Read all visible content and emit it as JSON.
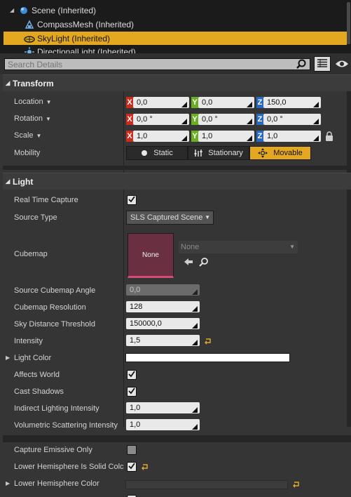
{
  "tree": {
    "items": [
      {
        "label": "Scene (Inherited)",
        "icon": "scene-icon",
        "expanded": true,
        "selected": false
      },
      {
        "label": "CompassMesh (Inherited)",
        "icon": "static-mesh-icon",
        "selected": false
      },
      {
        "label": "SkyLight (Inherited)",
        "icon": "skylight-icon",
        "selected": true
      },
      {
        "label": "DirectionalLight (Inherited)",
        "icon": "directional-light-icon",
        "selected": false
      }
    ]
  },
  "search": {
    "placeholder": "Search Details"
  },
  "transform": {
    "title": "Transform",
    "location_label": "Location",
    "rotation_label": "Rotation",
    "scale_label": "Scale",
    "mobility_label": "Mobility",
    "location": {
      "x": "0,0",
      "y": "0,0",
      "z": "150,0"
    },
    "rotation": {
      "x": "0,0 °",
      "y": "0,0 °",
      "z": "0,0 °"
    },
    "scale": {
      "x": "1,0",
      "y": "1,0",
      "z": "1,0"
    },
    "axis_x": "X",
    "axis_y": "Y",
    "axis_z": "Z",
    "mobility": {
      "static": "Static",
      "stationary": "Stationary",
      "movable": "Movable",
      "selected": "Movable"
    }
  },
  "light": {
    "title": "Light",
    "real_time_capture_label": "Real Time Capture",
    "real_time_capture": true,
    "source_type_label": "Source Type",
    "source_type": "SLS Captured Scene",
    "cubemap_label": "Cubemap",
    "cubemap_thumb": "None",
    "cubemap_asset": "None",
    "source_cubemap_angle_label": "Source Cubemap Angle",
    "source_cubemap_angle": "0,0",
    "cubemap_resolution_label": "Cubemap Resolution",
    "cubemap_resolution": "128",
    "sky_distance_threshold_label": "Sky Distance Threshold",
    "sky_distance_threshold": "150000,0",
    "intensity_label": "Intensity",
    "intensity": "1,5",
    "light_color_label": "Light Color",
    "light_color": "#ffffff",
    "affects_world_label": "Affects World",
    "affects_world": true,
    "cast_shadows_label": "Cast Shadows",
    "cast_shadows": true,
    "indirect_lighting_intensity_label": "Indirect Lighting Intensity",
    "indirect_lighting_intensity": "1,0",
    "volumetric_scattering_intensity_label": "Volumetric Scattering Intensity",
    "volumetric_scattering_intensity": "1,0",
    "capture_emissive_only_label": "Capture Emissive Only",
    "capture_emissive_only": false,
    "lower_hemisphere_solid_color_label": "Lower Hemisphere Is Solid Colc",
    "lower_hemisphere_solid_color": true,
    "lower_hemisphere_color_label": "Lower Hemisphere Color"
  },
  "colors": {
    "selection": "#e3a81f",
    "axis_x": "#c72c1f",
    "axis_y": "#6aaf22",
    "axis_z": "#2a69c2",
    "thumb": "#6a2f40"
  }
}
